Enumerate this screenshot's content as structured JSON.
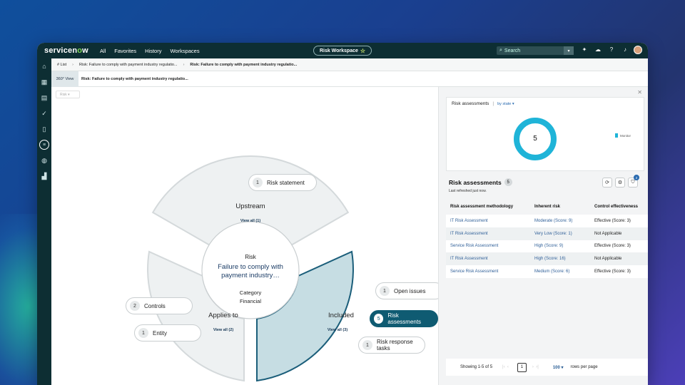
{
  "app": {
    "logo_part1": "servicen",
    "logo_o": "o",
    "logo_part2": "w",
    "nav": [
      "All",
      "Favorites",
      "History",
      "Workspaces"
    ],
    "workspace": "Risk Workspace",
    "search_placeholder": "Search"
  },
  "breadcrumb": {
    "list": "# List",
    "crumb1": "Risk: Failure to comply with payment industry regulatio...",
    "crumb2": "Risk: Failure to comply with payment industry regulatio..."
  },
  "tabs": {
    "view360": "360° View",
    "title": "Risk: Failure to comply with payment industry regulatio..."
  },
  "filter_chip": "Risk",
  "diagram": {
    "center_kind": "Risk",
    "center_title_line1": "Failure to comply with",
    "center_title_line2": "payment industry…",
    "category_label": "Category",
    "category_value": "Financial",
    "upstream_label": "Upstream",
    "upstream_view_all": "View all (1)",
    "applies_label": "Applies to",
    "applies_view_all": "View all (2)",
    "included_label": "Included",
    "included_view_all": "View all (3)",
    "pills": {
      "risk_statement": {
        "count": "1",
        "label": "Risk statement"
      },
      "controls": {
        "count": "2",
        "label": "Controls"
      },
      "entity": {
        "count": "1",
        "label": "Entity"
      },
      "open_issues": {
        "count": "1",
        "label": "Open issues"
      },
      "risk_assessments": {
        "count": "5",
        "label": "Risk assessments"
      },
      "risk_response_line1": "Risk response",
      "risk_response_line2": "tasks",
      "risk_response_count": "1"
    }
  },
  "chart_card": {
    "title": "Risk assessments",
    "separator": "|",
    "by": "by state",
    "donut_value": "5",
    "legend": "Monitor",
    "donut_color": "#1fb4d8"
  },
  "assessments": {
    "title": "Risk assessments",
    "count": "5",
    "refreshed": "Last refreshed just now.",
    "filter_badge": "2",
    "columns": [
      "Risk assessment methodology",
      "Inherent risk",
      "Control effectiveness"
    ],
    "rows": [
      [
        "IT Risk Assessment",
        "Moderate (Score: 9)",
        "Effective (Score: 3)"
      ],
      [
        "IT Risk Assessment",
        "Very Low (Score: 1)",
        "Not Applicable"
      ],
      [
        "Service Risk Assessment",
        "High (Score: 9)",
        "Effective (Score: 3)"
      ],
      [
        "IT Risk Assessment",
        "High (Score: 16)",
        "Not Applicable"
      ],
      [
        "Service Risk Assessment",
        "Medium (Score: 6)",
        "Effective (Score: 3)"
      ]
    ],
    "showing": "Showing 1-5 of 5",
    "page": "1",
    "rows_per_page": "100",
    "rows_per_page_label": "rows per page"
  }
}
